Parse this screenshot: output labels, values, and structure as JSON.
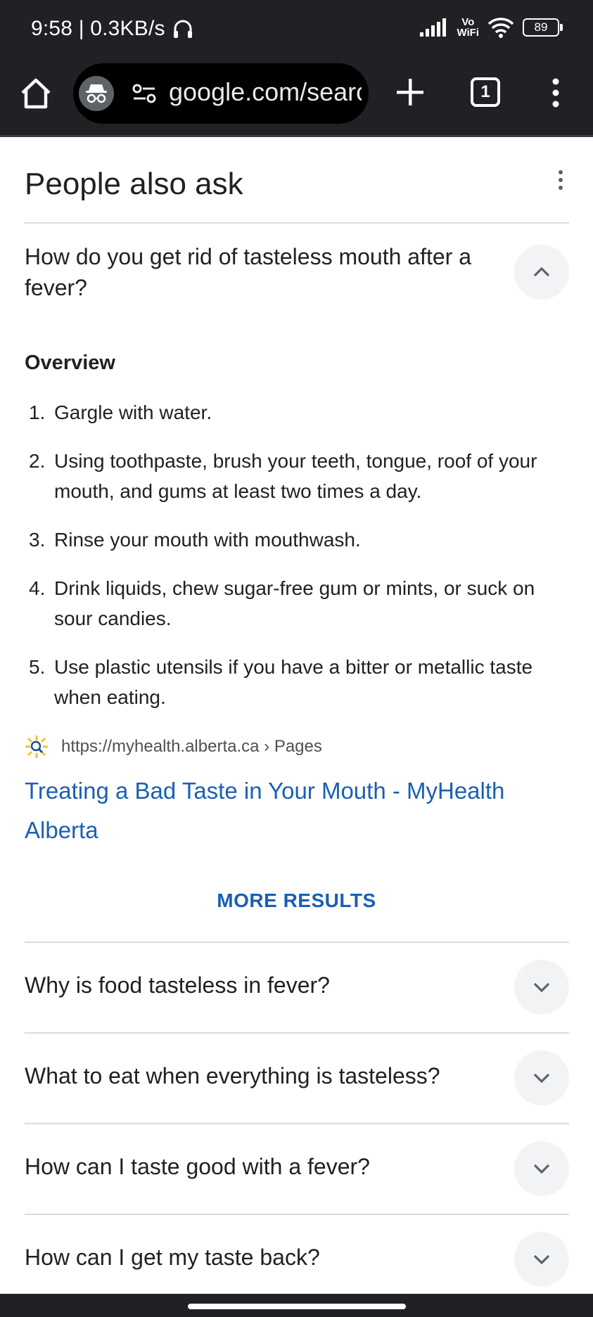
{
  "status_bar": {
    "time_speed": "9:58 | 0.3KB/s",
    "wifi_label_top": "Vo",
    "wifi_label_bottom": "WiFi",
    "battery": "89"
  },
  "toolbar": {
    "url": "google.com/search",
    "tab_count": "1"
  },
  "paa": {
    "title": "People also ask",
    "expanded": {
      "question": "How do you get rid of tasteless mouth after a fever?",
      "overview_label": "Overview",
      "steps": [
        {
          "num": "1.",
          "text": "Gargle with water."
        },
        {
          "num": "2.",
          "text": "Using toothpaste, brush your teeth, tongue, roof of your mouth, and gums at least two times a day."
        },
        {
          "num": "3.",
          "text": "Rinse your mouth with mouthwash."
        },
        {
          "num": "4.",
          "text": "Drink liquids, chew sugar-free gum or mints, or suck on sour candies."
        },
        {
          "num": "5.",
          "text": "Use plastic utensils if you have a bitter or metallic taste when eating."
        }
      ],
      "source_url": "https://myhealth.alberta.ca › Pages",
      "result_title": "Treating a Bad Taste in Your Mouth - MyHealth Alberta",
      "more_results": "MORE RESULTS"
    },
    "questions": [
      "Why is food tasteless in fever?",
      "What to eat when everything is tasteless?",
      "How can I taste good with a fever?",
      "How can I get my taste back?"
    ]
  },
  "colors": {
    "link": "#1a5fb4",
    "chrome_dark": "#202124",
    "chevron_bg": "#f1f3f4"
  }
}
